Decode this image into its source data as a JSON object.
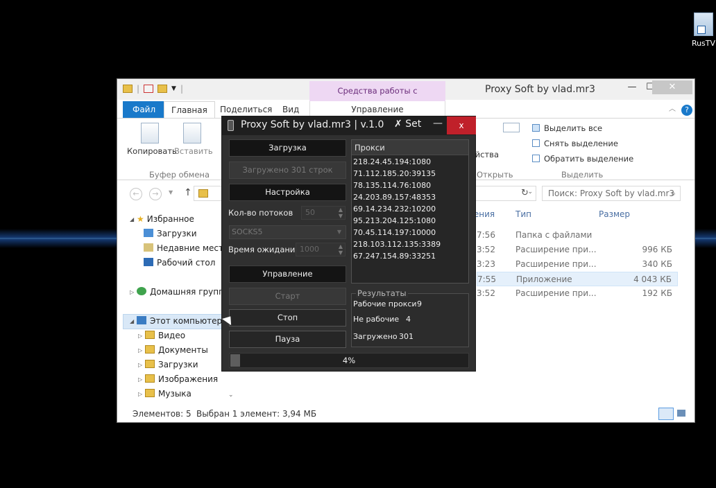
{
  "desktop": {
    "icon_label": "RusTV"
  },
  "explorer": {
    "window_title": "Proxy Soft by vlad.mr3",
    "app_tools_title": "Средства работы с приложениями",
    "app_tools_tab": "Управление",
    "tabs": [
      "Файл",
      "Главная",
      "Поделиться",
      "Вид"
    ],
    "ribbon": {
      "copy": "Копировать",
      "paste": "Вставить",
      "clipboard_group": "Буфер обмена",
      "properties_fragment": "йства",
      "open_fragment": "Открыть",
      "select_all": "Выделить все",
      "deselect": "Снять выделение",
      "invert": "Обратить выделение",
      "select_group": "Выделить"
    },
    "search_placeholder": "Поиск: Proxy Soft by vlad.mr3",
    "nav": {
      "favorites": "Избранное",
      "downloads": "Загрузки",
      "recent": "Недавние места",
      "desktop": "Рабочий стол",
      "homegroup": "Домашняя группа",
      "this_pc": "Этот компьютер",
      "video": "Видео",
      "documents": "Документы",
      "downloads2": "Загрузки",
      "images": "Изображения",
      "music": "Музыка"
    },
    "columns": {
      "date_fragment": "нения",
      "type": "Тип",
      "size": "Размер"
    },
    "files": [
      {
        "date": "7:56",
        "type": "Папка с файлами",
        "size": ""
      },
      {
        "date": "3:52",
        "type": "Расширение при...",
        "size": "996 КБ"
      },
      {
        "date": "3:23",
        "type": "Расширение при...",
        "size": "340 КБ"
      },
      {
        "date": "7:55",
        "type": "Приложение",
        "size": "4 043 КБ"
      },
      {
        "date": "3:52",
        "type": "Расширение при...",
        "size": "192 КБ"
      }
    ],
    "status": {
      "count": "Элементов: 5",
      "selected": "Выбран 1 элемент: 3,94 МБ"
    }
  },
  "proxy": {
    "title": "Proxy Soft by vlad.mr3 | v.1.0",
    "set": "Set",
    "close": "x",
    "load_btn": "Загрузка",
    "loaded_btn": "Загружено 301 строк",
    "settings_btn": "Настройка",
    "threads_label": "Кол-во потоков",
    "threads_value": "50",
    "socks_value": "SOCKS5",
    "timeout_label": "Время ожидания",
    "timeout_value": "1000",
    "control_btn": "Управление",
    "start_btn": "Старт",
    "stop_btn": "Стоп",
    "pause_btn": "Пауза",
    "list_header": "Прокси",
    "proxies": [
      "218.24.45.194:1080",
      "71.112.185.20:39135",
      "78.135.114.76:1080",
      "24.203.89.157:48353",
      "69.14.234.232:10200",
      "95.213.204.125:1080",
      "70.45.114.197:10000",
      "218.103.112.135:3389",
      "67.247.154.89:33251"
    ],
    "results_title": "Результаты",
    "working_label": "Рабочие прокси",
    "working_value": "9",
    "dead_label": "Не рабочие",
    "dead_value": "4",
    "loaded_label": "Загружено",
    "loaded_value": "301",
    "progress_label": "4%",
    "progress_fraction": 0.04
  }
}
